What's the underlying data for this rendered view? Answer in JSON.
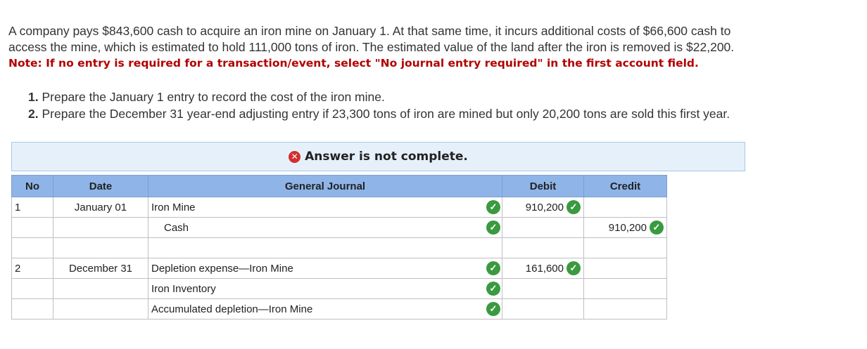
{
  "problem": {
    "line1": "A company pays $843,600 cash to acquire an iron mine on January 1. At that same time, it incurs additional costs of $66,600 cash to",
    "line2": "access the mine, which is estimated to hold 111,000 tons of iron. The estimated value of the land after the iron is removed is $22,200.",
    "note": "Note: If no entry is required for a transaction/event, select \"No journal entry required\" in the first account field."
  },
  "tasks": {
    "t1_num": "1.",
    "t1_text": "Prepare the January 1 entry to record the cost of the iron mine.",
    "t2_num": "2.",
    "t2_text": "Prepare the December 31 year-end adjusting entry if 23,300 tons of iron are mined but only 20,200 tons are sold this first year."
  },
  "banner": {
    "text": "Answer is not complete.",
    "icon": "x-circle-icon",
    "icon_color": "#d32f2f"
  },
  "table": {
    "headers": {
      "no": "No",
      "date": "Date",
      "journal": "General Journal",
      "debit": "Debit",
      "credit": "Credit"
    },
    "rows": [
      {
        "no": "1",
        "date": "January 01",
        "account": "Iron Mine",
        "debit": "910,200",
        "credit": ""
      },
      {
        "no": "",
        "date": "",
        "account": "Cash",
        "debit": "",
        "credit": "910,200"
      },
      {
        "no": "",
        "date": "",
        "account": "",
        "debit": "",
        "credit": ""
      },
      {
        "no": "2",
        "date": "December 31",
        "account": "Depletion expense—Iron Mine",
        "debit": "161,600",
        "credit": ""
      },
      {
        "no": "",
        "date": "",
        "account": "Iron Inventory",
        "debit": "",
        "credit": ""
      },
      {
        "no": "",
        "date": "",
        "account": "Accumulated depletion—Iron Mine",
        "debit": "",
        "credit": ""
      }
    ]
  },
  "colors": {
    "header_bg": "#8fb4e8",
    "check_green": "#3a9a3f",
    "note_red": "#b20000",
    "banner_bg": "#e6f0fa"
  }
}
